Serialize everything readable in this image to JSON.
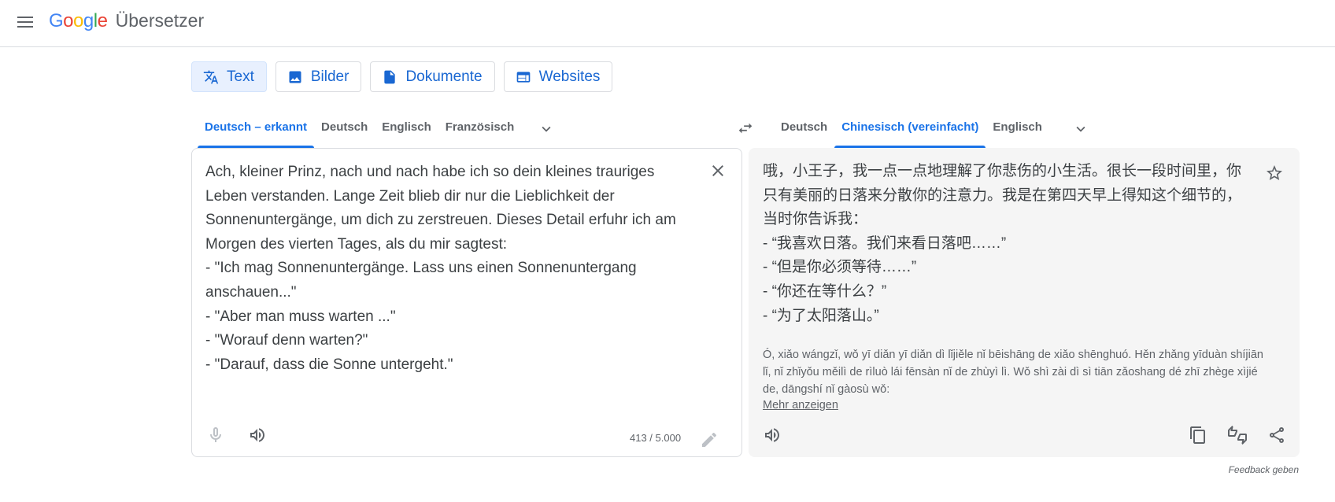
{
  "app": {
    "logo_letters": [
      "G",
      "o",
      "o",
      "g",
      "l",
      "e"
    ],
    "logo_colors": [
      "#4285f4",
      "#ea4335",
      "#fbbc05",
      "#4285f4",
      "#34a853",
      "#ea4335"
    ],
    "product_name": "Übersetzer"
  },
  "mode_tabs": [
    {
      "label": "Text",
      "icon": "translate-icon",
      "active": true
    },
    {
      "label": "Bilder",
      "icon": "image-icon",
      "active": false
    },
    {
      "label": "Dokumente",
      "icon": "document-icon",
      "active": false
    },
    {
      "label": "Websites",
      "icon": "website-icon",
      "active": false
    }
  ],
  "source_languages": [
    {
      "label": "Deutsch – erkannt",
      "active": true
    },
    {
      "label": "Deutsch",
      "active": false
    },
    {
      "label": "Englisch",
      "active": false
    },
    {
      "label": "Französisch",
      "active": false
    }
  ],
  "target_languages": [
    {
      "label": "Deutsch",
      "active": false
    },
    {
      "label": "Chinesisch (vereinfacht)",
      "active": true
    },
    {
      "label": "Englisch",
      "active": false
    }
  ],
  "source": {
    "text": "Ach, kleiner Prinz, nach und nach habe ich so dein kleines trauriges Leben verstanden. Lange Zeit blieb dir nur die Lieblichkeit der Sonnenuntergänge, um dich zu zerstreuen. Dieses Detail erfuhr ich am Morgen des vierten Tages, als du mir sagtest:\n- \"Ich mag Sonnenuntergänge. Lass uns einen Sonnenuntergang anschauen...\"\n- \"Aber man muss warten ...\"\n- \"Worauf denn warten?\"\n- \"Darauf, dass die Sonne untergeht.\"",
    "char_count": "413 / 5.000"
  },
  "target": {
    "text": "哦，小王子，我一点一点地理解了你悲伤的小生活。很长一段时间里，你只有美丽的日落来分散你的注意力。我是在第四天早上得知这个细节的，当时你告诉我：\n- “我喜欢日落。我们来看日落吧……”\n- “但是你必须等待……”\n- “你还在等什么？”\n- “为了太阳落山。”",
    "transliteration": "Ó, xiǎo wángzǐ, wǒ yī diǎn yī diǎn dì lǐjiěle nǐ bēishāng de xiǎo shēnghuó. Hěn zhǎng yīduàn shíjiān lǐ, nǐ zhǐyǒu měilì de rìluò lái fēnsàn nǐ de zhùyì lì. Wǒ shì zài dì sì tiān zǎoshang dé zhī zhège xìjié de, dāngshí nǐ gàosù wǒ:",
    "more_link": "Mehr anzeigen"
  },
  "feedback_label": "Feedback geben"
}
